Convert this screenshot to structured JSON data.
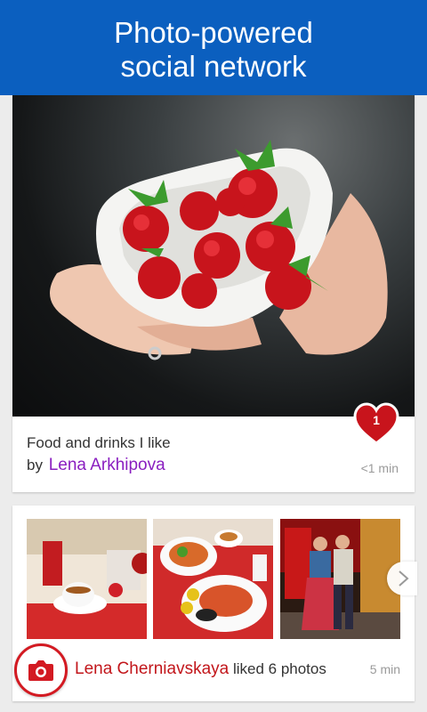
{
  "header": {
    "line1": "Photo-powered",
    "line2": "social network"
  },
  "post": {
    "title": "Food and drinks I like",
    "by_prefix": "by",
    "author": "Lena Arkhipova",
    "time": "<1 min",
    "likes": "1"
  },
  "activity": {
    "name": "Lena Cherniavskaya",
    "action": "liked 6 photos",
    "time": "5 min"
  },
  "colors": {
    "header": "#0b5fbf",
    "author": "#8a1fc0",
    "accent": "#d31a22"
  }
}
